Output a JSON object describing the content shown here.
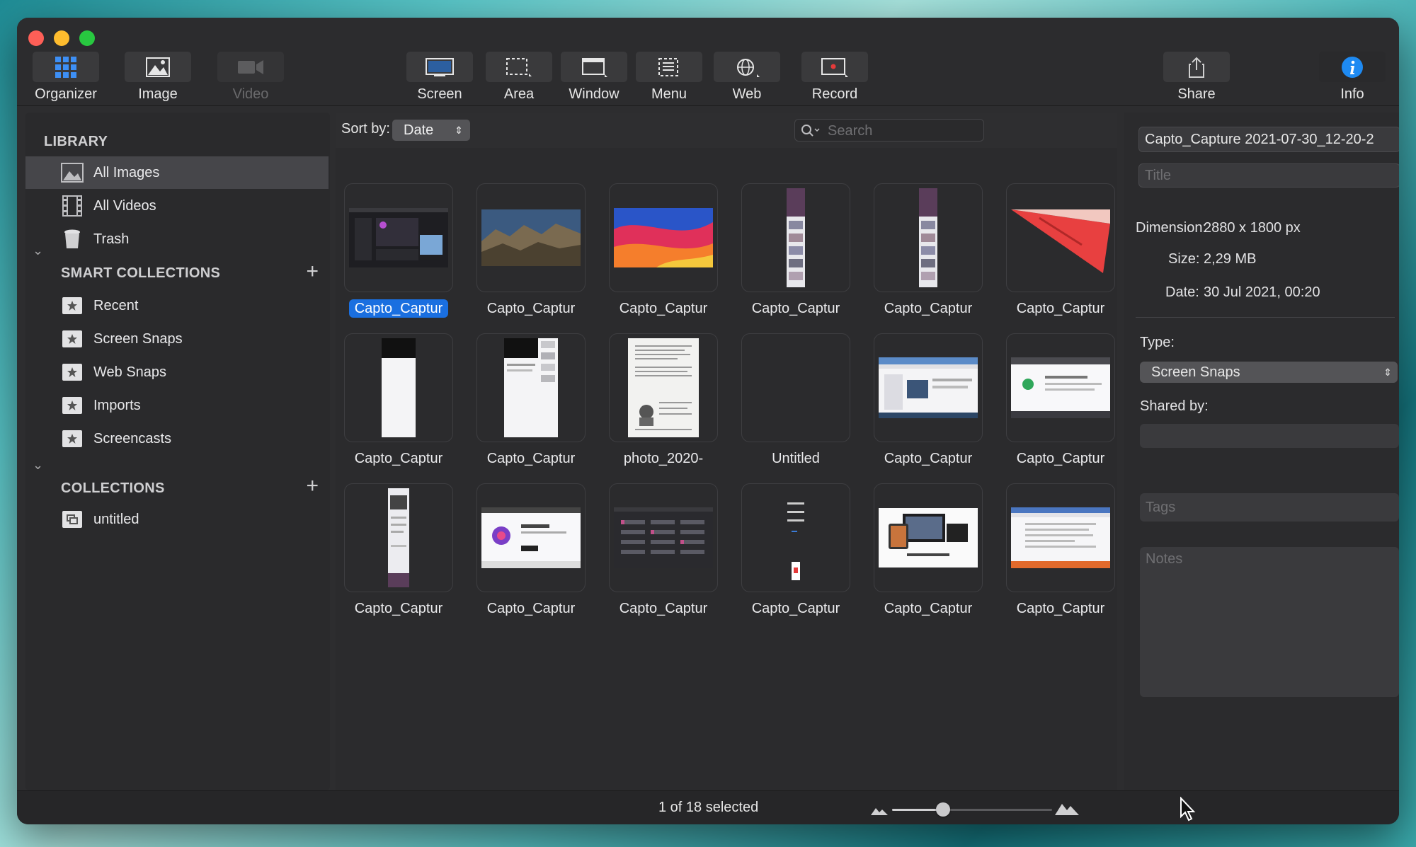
{
  "toolbar": {
    "items": [
      {
        "label": "Organizer",
        "icon": "grid-icon"
      },
      {
        "label": "Image",
        "icon": "image-icon"
      },
      {
        "label": "Video",
        "icon": "video-icon"
      },
      {
        "label": "Screen",
        "icon": "screen-icon"
      },
      {
        "label": "Area",
        "icon": "area-icon"
      },
      {
        "label": "Window",
        "icon": "window-icon"
      },
      {
        "label": "Menu",
        "icon": "menu-icon"
      },
      {
        "label": "Web",
        "icon": "globe-icon"
      },
      {
        "label": "Record",
        "icon": "record-icon"
      },
      {
        "label": "Share",
        "icon": "share-icon"
      },
      {
        "label": "Info",
        "icon": "info-icon"
      }
    ]
  },
  "sidebar": {
    "library_title": "LIBRARY",
    "library": [
      {
        "label": "All Images",
        "icon": "images-icon"
      },
      {
        "label": "All Videos",
        "icon": "film-icon"
      },
      {
        "label": "Trash",
        "icon": "trash-icon"
      }
    ],
    "smart_title": "SMART COLLECTIONS",
    "smart": [
      {
        "label": "Recent"
      },
      {
        "label": "Screen Snaps"
      },
      {
        "label": "Web Snaps"
      },
      {
        "label": "Imports"
      },
      {
        "label": "Screencasts"
      }
    ],
    "collections_title": "COLLECTIONS",
    "collections": [
      {
        "label": "untitled"
      }
    ]
  },
  "content": {
    "sort_label": "Sort by:",
    "sort_value": "Date",
    "search_placeholder": "Search",
    "items": [
      {
        "label": "Capto_Captur"
      },
      {
        "label": "Capto_Captur"
      },
      {
        "label": "Capto_Captur"
      },
      {
        "label": "Capto_Captur"
      },
      {
        "label": "Capto_Captur"
      },
      {
        "label": "Capto_Captur"
      },
      {
        "label": "Capto_Captur"
      },
      {
        "label": "Capto_Captur"
      },
      {
        "label": "photo_2020-"
      },
      {
        "label": "Untitled"
      },
      {
        "label": "Capto_Captur"
      },
      {
        "label": "Capto_Captur"
      },
      {
        "label": "Capto_Captur"
      },
      {
        "label": "Capto_Captur"
      },
      {
        "label": "Capto_Captur"
      },
      {
        "label": "Capto_Captur"
      },
      {
        "label": "Capto_Captur"
      },
      {
        "label": "Capto_Captur"
      }
    ]
  },
  "info": {
    "filename": "Capto_Capture 2021-07-30_12-20-2",
    "title_placeholder": "Title",
    "dimension_label": "Dimension:",
    "dimension_value": "2880 x 1800 px",
    "size_label": "Size:",
    "size_value": "2,29 MB",
    "date_label": "Date:",
    "date_value": "30 Jul 2021, 00:20",
    "type_label": "Type:",
    "type_value": "Screen Snaps",
    "shared_label": "Shared by:",
    "tags_placeholder": "Tags",
    "notes_placeholder": "Notes"
  },
  "status": {
    "selection": "1 of 18 selected",
    "zoom_level": 0.32
  },
  "colors": {
    "accent": "#1a6fe0",
    "close": "#fe5f57",
    "minimize": "#febc2e",
    "zoom": "#28c840"
  }
}
